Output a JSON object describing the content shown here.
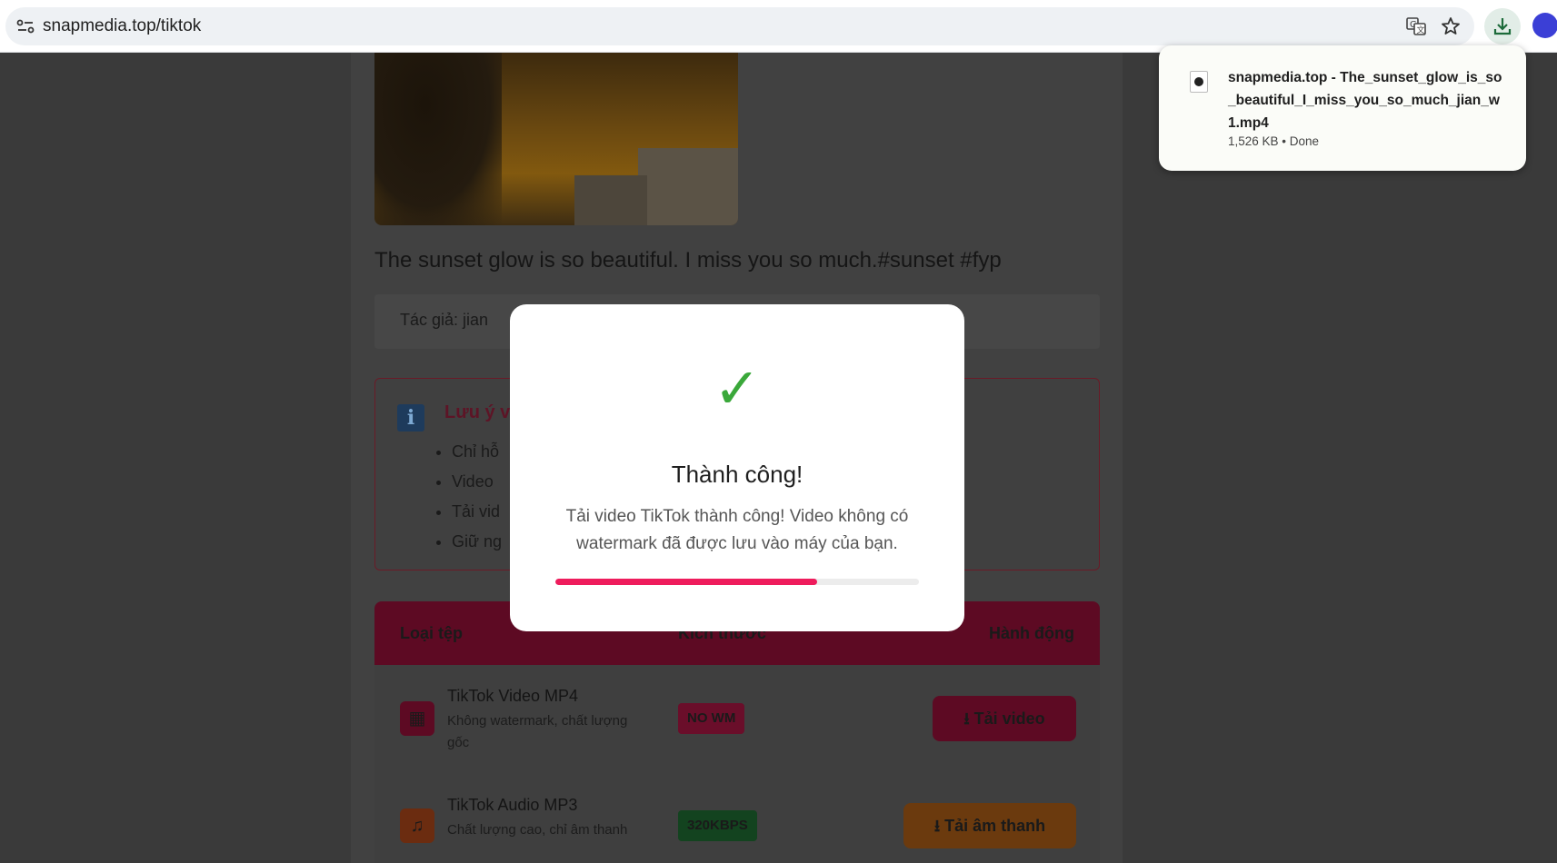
{
  "browser": {
    "url": "snapmedia.top/tiktok",
    "icons": [
      "site-info-icon",
      "translate-icon",
      "bookmark-star-icon",
      "download-icon",
      "profile-avatar"
    ]
  },
  "download": {
    "file_name": "snapmedia.top - The_sunset_glow_is_so_beautiful_I_miss_you_so_much_jian_w1.mp4",
    "status": "1,526 KB • Done"
  },
  "video": {
    "caption": "The sunset glow is so beautiful. I miss you so much.#sunset #fyp",
    "author": "Tác giả: jian"
  },
  "notice": {
    "title": "Lưu ý về",
    "items": [
      "Chỉ hỗ",
      "Video",
      "Tải vid",
      "Giữ ng"
    ]
  },
  "table": {
    "headers": [
      "Loại tệp",
      "Kích thước",
      "Hành động"
    ],
    "rows": [
      {
        "title": "TikTok Video MP4",
        "subtitle": "Không watermark, chất lượng gốc",
        "badge": "NO WM",
        "action": "Tải video",
        "icon": "film-icon"
      },
      {
        "title": "TikTok Audio MP3",
        "subtitle": "Chất lượng cao, chỉ âm thanh",
        "badge": "320KBPS",
        "action": "Tải âm thanh",
        "icon": "music-note-icon"
      }
    ]
  },
  "modal": {
    "icon": "check-icon",
    "title": "Thành công!",
    "message": "Tải video TikTok thành công! Video không có watermark đã được lưu vào máy của bạn.",
    "progress": 0.72
  },
  "colors": {
    "accent": "#ee1c5c",
    "success": "#3aa83a",
    "header_maroon": "#5d0a23"
  }
}
